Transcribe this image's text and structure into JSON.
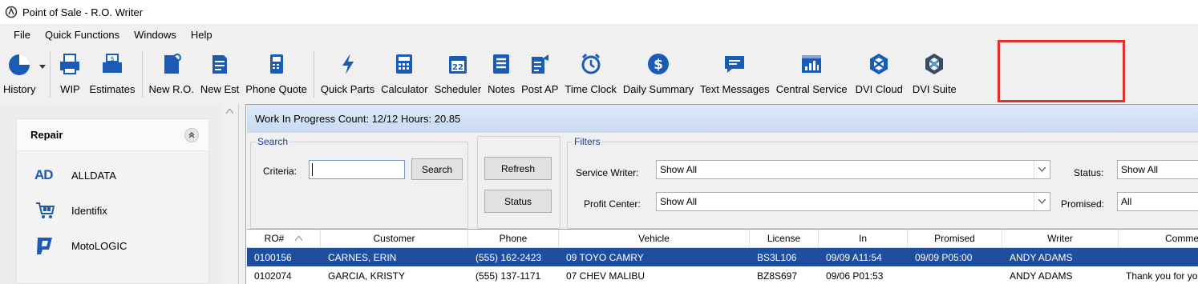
{
  "window": {
    "title": "Point of Sale - R.O. Writer"
  },
  "menu": [
    "File",
    "Quick Functions",
    "Windows",
    "Help"
  ],
  "toolbar": {
    "history": "History",
    "wip": "WIP",
    "estimates": "Estimates",
    "new_ro": "New R.O.",
    "new_est": "New Est",
    "phone_quote": "Phone Quote",
    "quick_parts": "Quick Parts",
    "calculator": "Calculator",
    "scheduler": "Scheduler",
    "scheduler_day": "22",
    "notes": "Notes",
    "post_ap": "Post AP",
    "time_clock": "Time Clock",
    "daily_summary": "Daily Summary",
    "text_messages": "Text Messages",
    "central_service": "Central Service",
    "dvi_cloud": "DVI Cloud",
    "dvi_suite": "DVI Suite"
  },
  "sidebar": {
    "section_title": "Repair",
    "items": [
      {
        "label": "ALLDATA",
        "logo": "AD"
      },
      {
        "label": "Identifix"
      },
      {
        "label": "MotoLOGIC"
      }
    ]
  },
  "wip": {
    "header": "Work In Progress  Count: 12/12  Hours: 20.85",
    "search": {
      "legend": "Search",
      "criteria_label": "Criteria:",
      "criteria_value": "",
      "search_button": "Search"
    },
    "refresh_button": "Refresh",
    "status_button": "Status",
    "filters": {
      "legend": "Filters",
      "service_writer_label": "Service Writer:",
      "service_writer_value": "Show All",
      "profit_center_label": "Profit Center:",
      "profit_center_value": "Show All",
      "status_label": "Status:",
      "status_value": "Show All",
      "promised_label": "Promised:",
      "promised_value": "All"
    },
    "columns": [
      "RO#",
      "Customer",
      "Phone",
      "Vehicle",
      "License",
      "In",
      "Promised",
      "Writer",
      "Comme"
    ],
    "rows": [
      {
        "ro": "0100156",
        "customer": "CARNES, ERIN",
        "phone": "(555) 162-2423",
        "vehicle": "09 TOYO CAMRY",
        "license": "BS3L106",
        "in": "09/09 A11:54",
        "promised": "09/09 P05:00",
        "writer": "ANDY ADAMS",
        "comments": ""
      },
      {
        "ro": "0102074",
        "customer": "GARCIA, KRISTY",
        "phone": "(555) 137-1171",
        "vehicle": "07 CHEV MALIBU",
        "license": "BZ8S697",
        "in": "09/06 P01:53",
        "promised": "",
        "writer": "ANDY ADAMS",
        "comments": "Thank you for yo"
      }
    ]
  },
  "colors": {
    "accent": "#1a5bb5",
    "selected_row": "#1f4e9e",
    "highlight_box": "#e03030"
  }
}
